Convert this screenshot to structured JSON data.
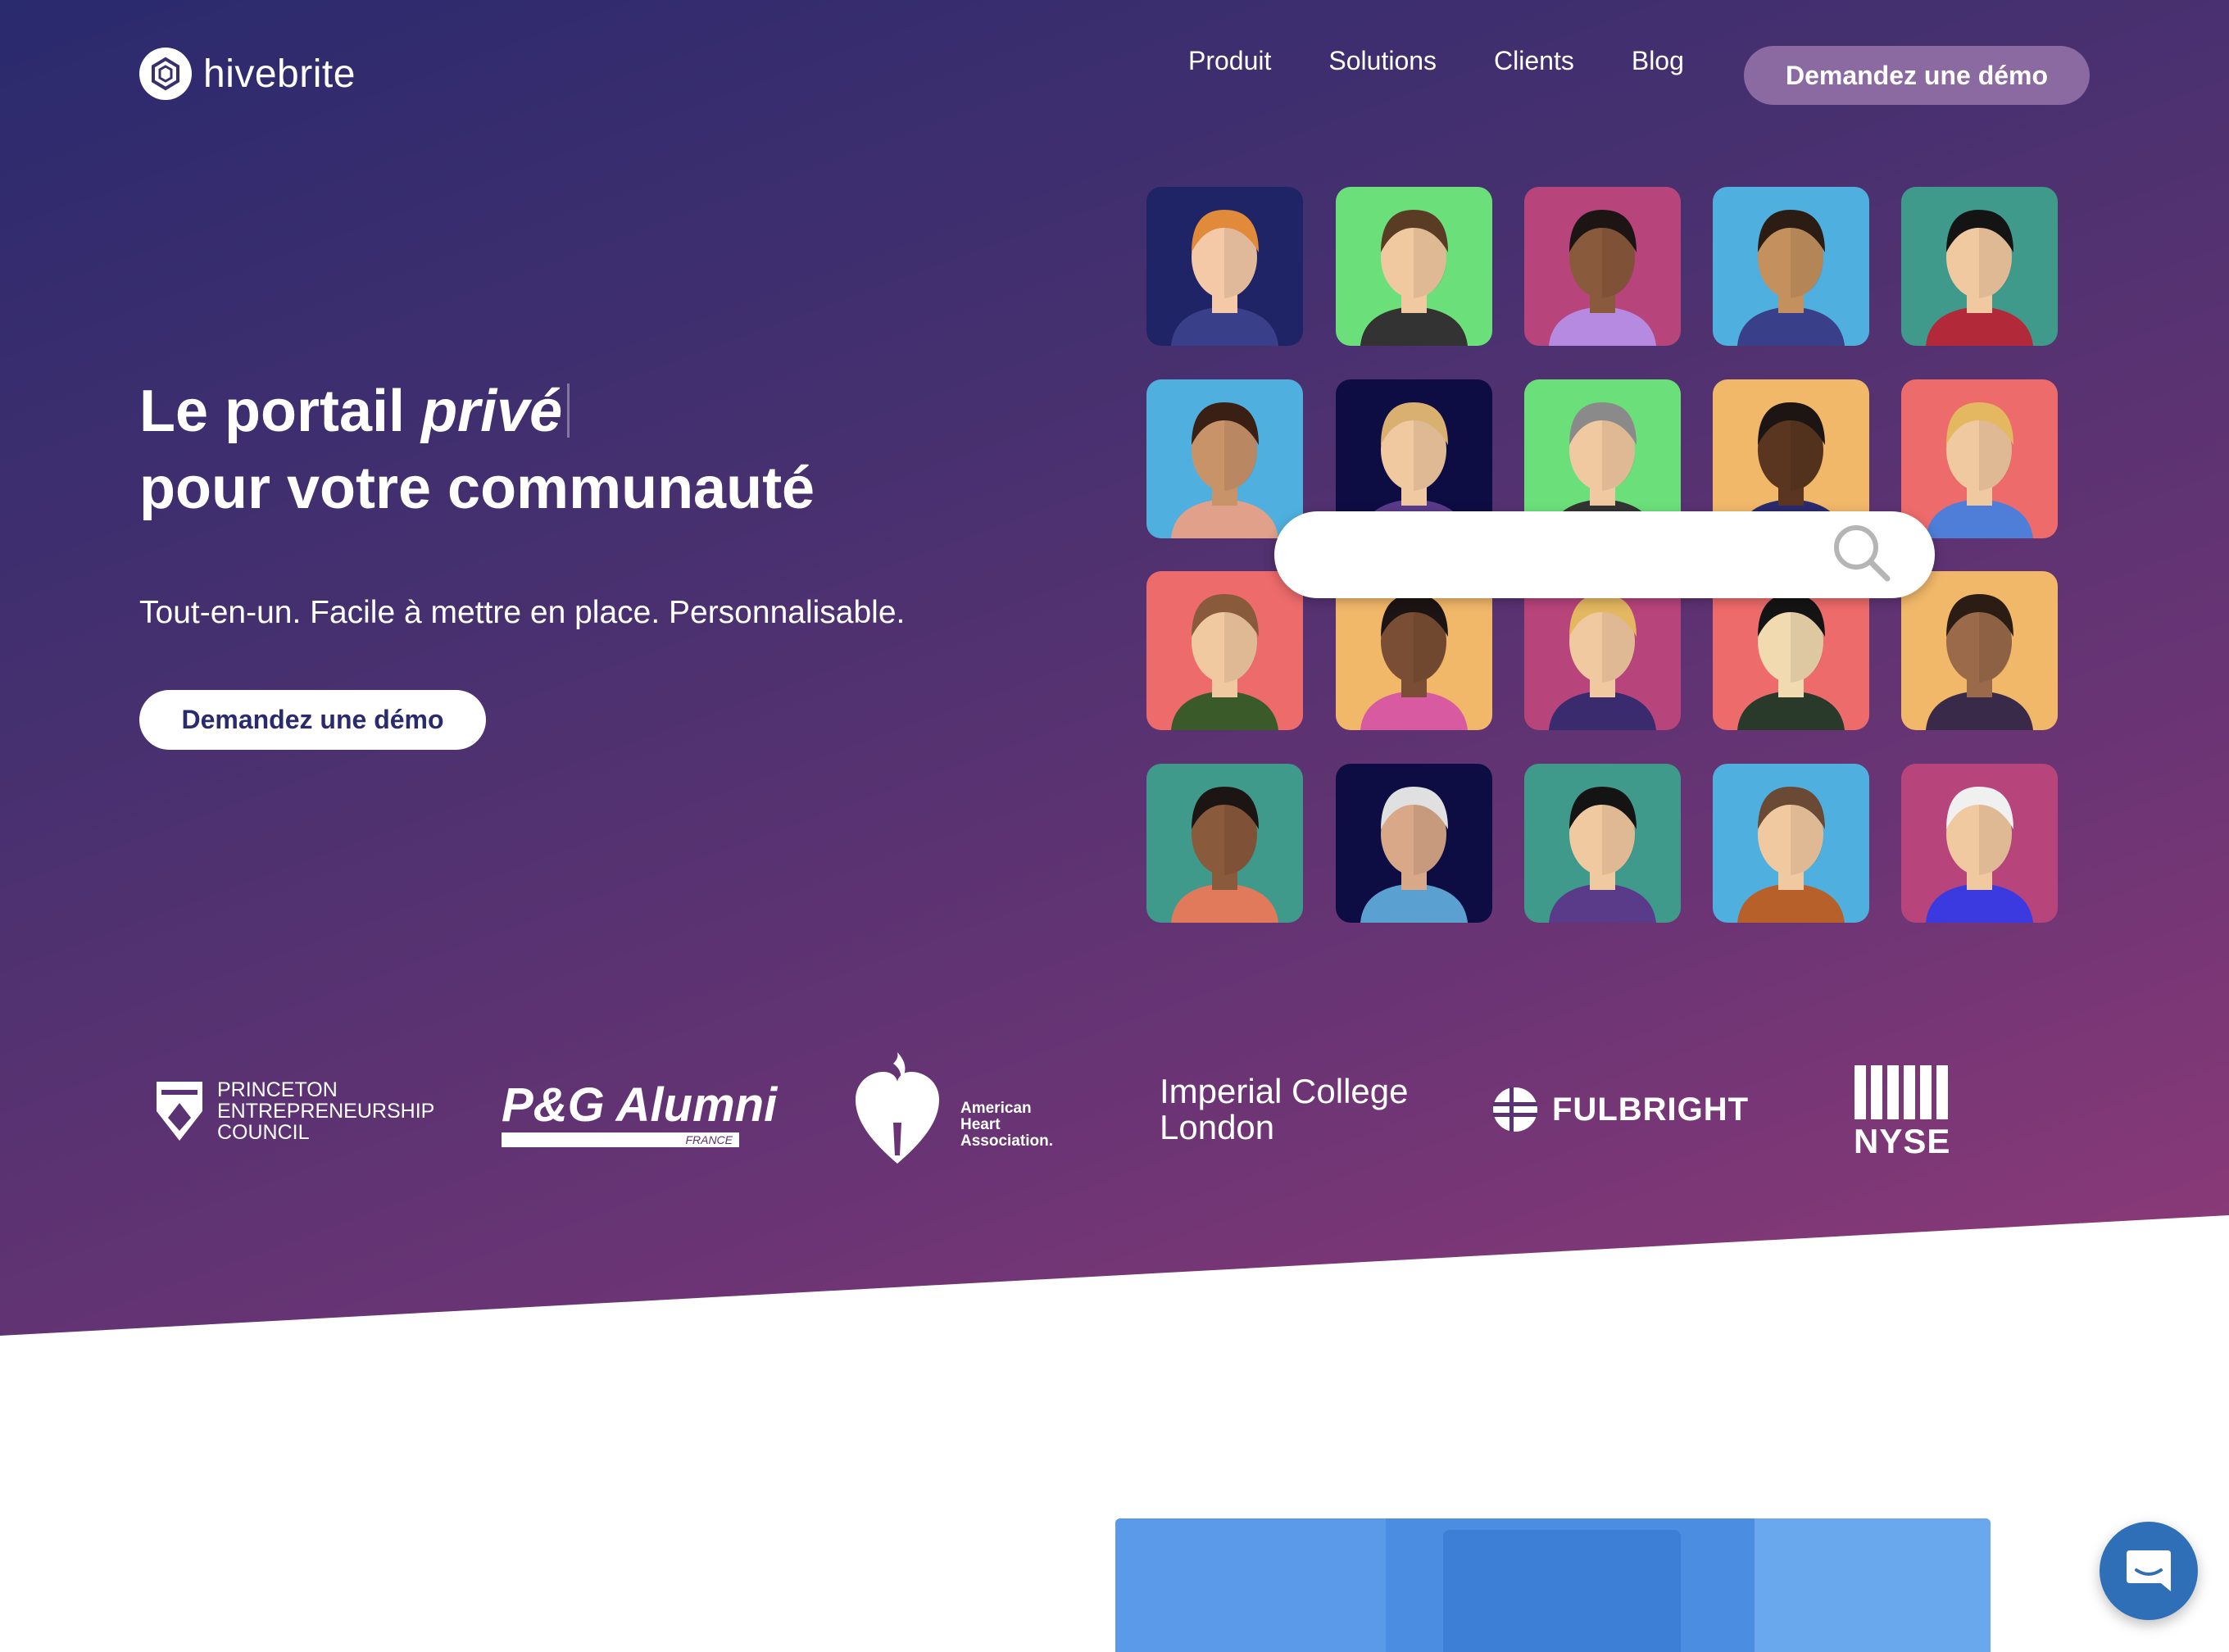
{
  "brand": {
    "name": "hivebrite"
  },
  "nav": {
    "items": [
      {
        "label": "Produit"
      },
      {
        "label": "Solutions"
      },
      {
        "label": "Clients"
      },
      {
        "label": "Blog"
      }
    ],
    "cta": "Demandez une démo"
  },
  "hero": {
    "headline_line1_prefix": "Le portail",
    "headline_line1_emphasis": "privé",
    "headline_line2": "pour votre communauté",
    "subheadline": "Tout-en-un. Facile à mettre en place. Personnalisable.",
    "cta": "Demandez une démo"
  },
  "search": {
    "placeholder": ""
  },
  "clients": {
    "princeton": [
      "PRINCETON",
      "ENTREPRENEURSHIP",
      "COUNCIL"
    ],
    "pg": {
      "main": "P&G Alumni",
      "sub": "FRANCE"
    },
    "aha": [
      "American",
      "Heart",
      "Association."
    ],
    "imperial": [
      "Imperial College",
      "London"
    ],
    "fulbright": "FULBRIGHT",
    "nyse": "NYSE"
  },
  "colors": {
    "hero_start": "#2a2a6e",
    "hero_end": "#8f3a78",
    "nav_cta_bg": "#8b6aa2",
    "chat_bg": "#2e6fb8"
  },
  "avatars": [
    {
      "bg": "#1f2466",
      "skin": "#f3c9a8",
      "hair": "#e08a3a",
      "shirt": "#3a3f8a"
    },
    {
      "bg": "#6be07a",
      "skin": "#f1c9a0",
      "hair": "#5a3b24",
      "shirt": "#333333"
    },
    {
      "bg": "#b8447c",
      "skin": "#8a5a3c",
      "hair": "#1d1414",
      "shirt": "#b58ae0"
    },
    {
      "bg": "#4fb0e0",
      "skin": "#c4915e",
      "hair": "#2b1d14",
      "shirt": "#3a3f8a"
    },
    {
      "bg": "#3f9a8c",
      "skin": "#f1c9a0",
      "hair": "#141414",
      "shirt": "#b22a3a"
    },
    {
      "bg": "#4fb0e0",
      "skin": "#c9936a",
      "hair": "#3a1f14",
      "shirt": "#e0a08a"
    },
    {
      "bg": "#0d0d44",
      "skin": "#f1c9a0",
      "hair": "#d9b070",
      "shirt": "#5a3b8a"
    },
    {
      "bg": "#6be07a",
      "skin": "#f1c9a0",
      "hair": "#8a8a8a",
      "shirt": "#333333"
    },
    {
      "bg": "#f2b86a",
      "skin": "#5a3620",
      "hair": "#1d1414",
      "shirt": "#2a2a6e"
    },
    {
      "bg": "#ee6b6b",
      "skin": "#f1c9a0",
      "hair": "#e4b860",
      "shirt": "#4f7ed8"
    },
    {
      "bg": "#ee6b6b",
      "skin": "#f1c9a0",
      "hair": "#8a5a3c",
      "shirt": "#3a5a2a"
    },
    {
      "bg": "#f2b86a",
      "skin": "#7a4e34",
      "hair": "#1d1414",
      "shirt": "#d85aa0"
    },
    {
      "bg": "#b8447c",
      "skin": "#f1c9a0",
      "hair": "#e4b860",
      "shirt": "#3a2a6e"
    },
    {
      "bg": "#ee6b6b",
      "skin": "#f1d9b0",
      "hair": "#141414",
      "shirt": "#2a3a2a"
    },
    {
      "bg": "#f2b86a",
      "skin": "#9a6a4a",
      "hair": "#2b1d14",
      "shirt": "#3a2a4a"
    },
    {
      "bg": "#3f9a8c",
      "skin": "#8a5a3c",
      "hair": "#1d1414",
      "shirt": "#e07a5a"
    },
    {
      "bg": "#0d0d44",
      "skin": "#d9a888",
      "hair": "#e0e0e0",
      "shirt": "#5aa0d0"
    },
    {
      "bg": "#3f9a8c",
      "skin": "#f1c9a0",
      "hair": "#141414",
      "shirt": "#5a3b8a"
    },
    {
      "bg": "#4fb0e0",
      "skin": "#f1c9a0",
      "hair": "#6a4a34",
      "shirt": "#b8602a"
    },
    {
      "bg": "#b8447c",
      "skin": "#f1c9a0",
      "hair": "#f0f0f0",
      "shirt": "#3a3ae0"
    }
  ]
}
